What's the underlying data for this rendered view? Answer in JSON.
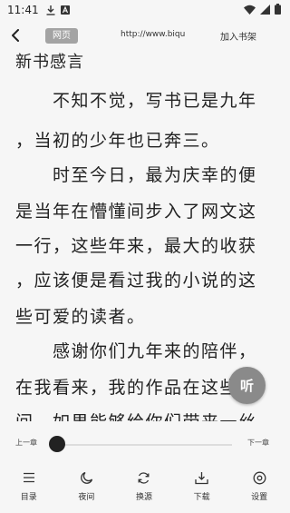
{
  "status_bar": {
    "time": "11:41",
    "left_icons": [
      "download-icon",
      "app-a-icon"
    ],
    "right_icons": [
      "wifi-icon",
      "signal-icon",
      "battery-icon"
    ]
  },
  "top_bar": {
    "back_icon": "back-arrow-icon",
    "web_label": "网页",
    "url": "http://www.biqu",
    "add_to_shelf": "加入书架"
  },
  "chapter": {
    "title": "新书感言",
    "lines": [
      "　　不知不觉，写书已是九年",
      "，当初的少年也已奔三。",
      "　　时至今日，最为庆幸的便",
      "是当年在懵懂间步入了网文这",
      "一行，这些年来，最大的收获",
      "，应该便是看过我的小说的这",
      "些可爱的读者。",
      "　　感谢你们九年来的陪伴，",
      "在我看来，我的作品在这些年",
      "间，如果能够给你们带来一丝"
    ]
  },
  "listen_button": {
    "label": "听"
  },
  "progress": {
    "prev_label": "上一章",
    "next_label": "下一章",
    "position": 0.0
  },
  "bottom_nav": [
    {
      "label": "目录",
      "icon": "list-icon"
    },
    {
      "label": "夜间",
      "icon": "moon-icon"
    },
    {
      "label": "换源",
      "icon": "refresh-icon"
    },
    {
      "label": "下载",
      "icon": "download-tray-icon"
    },
    {
      "label": "设置",
      "icon": "settings-icon"
    }
  ],
  "colors": {
    "background": "#f6f6f6",
    "text": "#222222",
    "badge": "#a3a3a3",
    "listen_button": "#8a8a8a"
  }
}
